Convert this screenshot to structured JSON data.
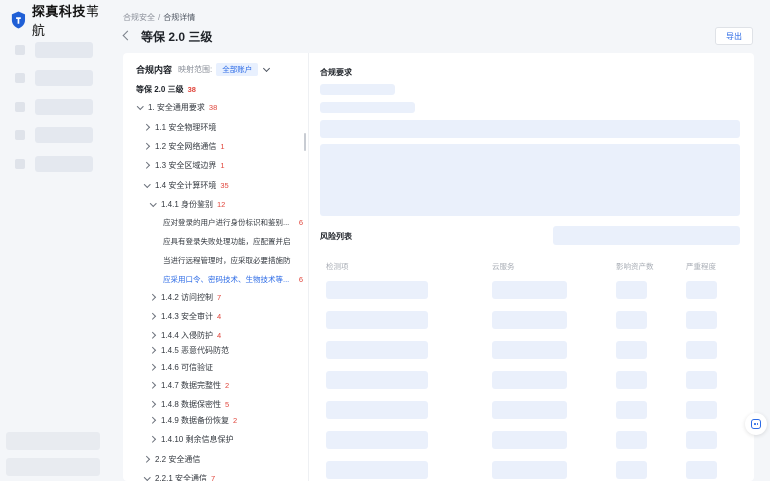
{
  "brand": {
    "name": "探真科技",
    "sub": "苇航"
  },
  "breadcrumb": {
    "root": "合规安全",
    "separator": "/",
    "current": "合规详情"
  },
  "page": {
    "title": "等保 2.0 三级",
    "export_label": "导出"
  },
  "tree_panel": {
    "heading": "合规内容",
    "scope_label": "映射范围:",
    "scope_value": "全部账户",
    "root": {
      "label": "等保 2.0 三级",
      "count": "38"
    },
    "nodes": [
      {
        "label": "1. 安全通用要求",
        "count": "38"
      },
      {
        "label": "1.1 安全物理环境",
        "count": ""
      },
      {
        "label": "1.2 安全网络通信",
        "count": "1"
      },
      {
        "label": "1.3 安全区域边界",
        "count": "1"
      },
      {
        "label": "1.4 安全计算环境",
        "count": "35"
      },
      {
        "label": "1.4.1 身份鉴别",
        "count": "12"
      }
    ],
    "leaves": [
      {
        "label": "应对登录的用户进行身份标识和鉴别...",
        "count": "6"
      },
      {
        "label": "应具有登录失败处理功能，应配置并启...",
        "count": ""
      },
      {
        "label": "当进行远程管理时，应采取必要措施防...",
        "count": ""
      },
      {
        "label": "应采用口令、密码技术、生物技术等...",
        "count": "6"
      }
    ],
    "subnodes": [
      {
        "label": "1.4.2 访问控制",
        "count": "7"
      },
      {
        "label": "1.4.3 安全审计",
        "count": "4"
      },
      {
        "label": "1.4.4 入侵防护",
        "count": "4"
      },
      {
        "label": "1.4.5 恶意代码防范",
        "count": ""
      },
      {
        "label": "1.4.6 可信验证",
        "count": ""
      },
      {
        "label": "1.4.7 数据完整性",
        "count": "2"
      },
      {
        "label": "1.4.8 数据保密性",
        "count": "5"
      },
      {
        "label": "1.4.9 数据备份恢复",
        "count": "2"
      },
      {
        "label": "1.4.10 剩余信息保护",
        "count": ""
      }
    ],
    "tail": [
      {
        "label": "2.2 安全通信",
        "count": ""
      },
      {
        "label": "2.2.1 安全通信",
        "count": "7"
      }
    ]
  },
  "requirements": {
    "title": "合规要求"
  },
  "risks": {
    "title": "风险列表",
    "columns": [
      "检测项",
      "云服务",
      "影响资产数",
      "严重程度"
    ]
  },
  "colors": {
    "accent": "#2b6ae6",
    "danger": "#e0443a",
    "skeleton": "#eaf0fb"
  },
  "icons": {
    "back": "chevron-left-icon",
    "expand": "chevron-down-icon",
    "assistant": "robot-icon"
  }
}
